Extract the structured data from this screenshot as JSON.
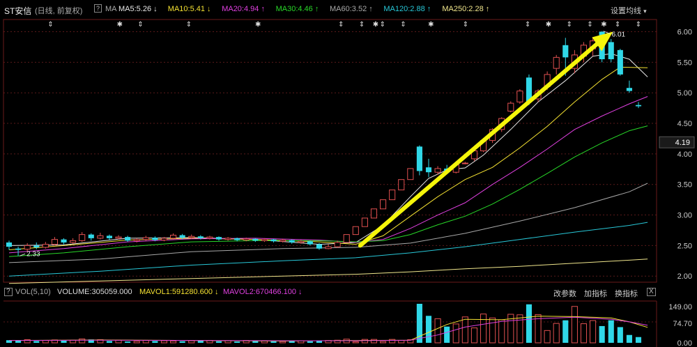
{
  "header": {
    "stock_name": "ST安信",
    "period_label": "(日线, 前复权)",
    "help_icon": "?",
    "ma_label": "MA",
    "ma_items": [
      {
        "text": "MA5:5.26",
        "arrow": "↓",
        "color": "#e8e8e8"
      },
      {
        "text": "MA10:5.41",
        "arrow": "↓",
        "color": "#f5e232"
      },
      {
        "text": "MA20:4.94",
        "arrow": "↑",
        "color": "#e040e0"
      },
      {
        "text": "MA30:4.46",
        "arrow": "↑",
        "color": "#28d828"
      },
      {
        "text": "MA60:3.52",
        "arrow": "↑",
        "color": "#a8a8a8"
      },
      {
        "text": "MA120:2.88",
        "arrow": "↑",
        "color": "#28c8d8"
      },
      {
        "text": "MA250:2.28",
        "arrow": "↑",
        "color": "#f0e68c"
      }
    ],
    "settings_label": "设置均线",
    "settings_arrow": "▾"
  },
  "volume_bar": {
    "help_icon": "?",
    "vol_label": "VOL(5,10)",
    "volume_text": "VOLUME:305059.000",
    "mavol1_text": "MAVOL1:591280.600",
    "mavol1_arrow": "↓",
    "mavol2_text": "MAVOL2:670466.100",
    "mavol2_arrow": "↓",
    "btn_params": "改参数",
    "btn_add": "加指标",
    "btn_switch": "换指标",
    "close_icon": "X"
  },
  "price_axis": {
    "ticks": [
      "6.00",
      "5.50",
      "5.00",
      "4.50",
      "4.00",
      "3.50",
      "3.00",
      "2.50",
      "2.00"
    ],
    "current_price": "4.19"
  },
  "volume_axis": {
    "ticks": [
      "149.00",
      "74.70",
      "0.00"
    ]
  },
  "annotations": {
    "high_label": "6.01",
    "low_label": "2.33"
  },
  "colors": {
    "up": "#e05050",
    "down": "#30d8e8",
    "arrow": "#f5f50a",
    "grid": "#5a1a1a"
  },
  "chart_data": {
    "type": "candlestick",
    "title": "ST安信",
    "ylim": [
      1.9,
      6.2
    ],
    "volume_ylim": [
      0,
      149
    ],
    "candles": [
      {
        "o": 2.55,
        "c": 2.48,
        "h": 2.58,
        "l": 2.43
      },
      {
        "o": 2.45,
        "c": 2.43,
        "h": 2.48,
        "l": 2.33
      },
      {
        "o": 2.44,
        "c": 2.5,
        "h": 2.54,
        "l": 2.4
      },
      {
        "o": 2.5,
        "c": 2.47,
        "h": 2.55,
        "l": 2.44
      },
      {
        "o": 2.47,
        "c": 2.52,
        "h": 2.56,
        "l": 2.45
      },
      {
        "o": 2.52,
        "c": 2.6,
        "h": 2.64,
        "l": 2.5
      },
      {
        "o": 2.6,
        "c": 2.55,
        "h": 2.62,
        "l": 2.52
      },
      {
        "o": 2.55,
        "c": 2.58,
        "h": 2.62,
        "l": 2.53
      },
      {
        "o": 2.58,
        "c": 2.68,
        "h": 2.72,
        "l": 2.56
      },
      {
        "o": 2.68,
        "c": 2.62,
        "h": 2.7,
        "l": 2.58
      },
      {
        "o": 2.62,
        "c": 2.66,
        "h": 2.71,
        "l": 2.6
      },
      {
        "o": 2.66,
        "c": 2.62,
        "h": 2.68,
        "l": 2.59
      },
      {
        "o": 2.62,
        "c": 2.64,
        "h": 2.67,
        "l": 2.6
      },
      {
        "o": 2.64,
        "c": 2.58,
        "h": 2.66,
        "l": 2.56
      },
      {
        "o": 2.58,
        "c": 2.6,
        "h": 2.62,
        "l": 2.55
      },
      {
        "o": 2.6,
        "c": 2.63,
        "h": 2.66,
        "l": 2.58
      },
      {
        "o": 2.63,
        "c": 2.59,
        "h": 2.65,
        "l": 2.57
      },
      {
        "o": 2.59,
        "c": 2.62,
        "h": 2.64,
        "l": 2.57
      },
      {
        "o": 2.62,
        "c": 2.67,
        "h": 2.7,
        "l": 2.6
      },
      {
        "o": 2.67,
        "c": 2.63,
        "h": 2.69,
        "l": 2.6
      },
      {
        "o": 2.63,
        "c": 2.65,
        "h": 2.68,
        "l": 2.61
      },
      {
        "o": 2.65,
        "c": 2.62,
        "h": 2.67,
        "l": 2.6
      },
      {
        "o": 2.62,
        "c": 2.64,
        "h": 2.66,
        "l": 2.6
      },
      {
        "o": 2.64,
        "c": 2.6,
        "h": 2.65,
        "l": 2.58
      },
      {
        "o": 2.6,
        "c": 2.62,
        "h": 2.64,
        "l": 2.58
      },
      {
        "o": 2.62,
        "c": 2.59,
        "h": 2.63,
        "l": 2.57
      },
      {
        "o": 2.59,
        "c": 2.61,
        "h": 2.63,
        "l": 2.57
      },
      {
        "o": 2.61,
        "c": 2.58,
        "h": 2.62,
        "l": 2.56
      },
      {
        "o": 2.58,
        "c": 2.6,
        "h": 2.62,
        "l": 2.56
      },
      {
        "o": 2.6,
        "c": 2.57,
        "h": 2.61,
        "l": 2.55
      },
      {
        "o": 2.57,
        "c": 2.59,
        "h": 2.61,
        "l": 2.55
      },
      {
        "o": 2.59,
        "c": 2.55,
        "h": 2.6,
        "l": 2.53
      },
      {
        "o": 2.55,
        "c": 2.57,
        "h": 2.59,
        "l": 2.53
      },
      {
        "o": 2.57,
        "c": 2.52,
        "h": 2.58,
        "l": 2.5
      },
      {
        "o": 2.52,
        "c": 2.45,
        "h": 2.54,
        "l": 2.43
      },
      {
        "o": 2.45,
        "c": 2.48,
        "h": 2.52,
        "l": 2.44
      },
      {
        "o": 2.48,
        "c": 2.55,
        "h": 2.58,
        "l": 2.46
      },
      {
        "o": 2.55,
        "c": 2.68,
        "h": 2.68,
        "l": 2.55
      },
      {
        "o": 2.68,
        "c": 2.81,
        "h": 2.81,
        "l": 2.68
      },
      {
        "o": 2.81,
        "c": 2.95,
        "h": 2.95,
        "l": 2.81
      },
      {
        "o": 2.95,
        "c": 3.1,
        "h": 3.1,
        "l": 2.95
      },
      {
        "o": 3.1,
        "c": 3.25,
        "h": 3.25,
        "l": 3.1
      },
      {
        "o": 3.25,
        "c": 3.41,
        "h": 3.41,
        "l": 3.25
      },
      {
        "o": 3.41,
        "c": 3.58,
        "h": 3.58,
        "l": 3.41
      },
      {
        "o": 3.58,
        "c": 3.76,
        "h": 3.76,
        "l": 3.58
      },
      {
        "o": 4.12,
        "c": 3.72,
        "h": 4.14,
        "l": 3.65
      },
      {
        "o": 3.78,
        "c": 3.7,
        "h": 3.92,
        "l": 3.62
      },
      {
        "o": 3.7,
        "c": 3.76,
        "h": 3.8,
        "l": 3.66
      },
      {
        "o": 3.76,
        "c": 3.7,
        "h": 3.82,
        "l": 3.68
      },
      {
        "o": 3.7,
        "c": 3.82,
        "h": 3.84,
        "l": 3.68
      },
      {
        "o": 3.85,
        "c": 3.85,
        "h": 3.87,
        "l": 3.83
      },
      {
        "o": 3.92,
        "c": 4.05,
        "h": 4.08,
        "l": 3.88
      },
      {
        "o": 4.05,
        "c": 4.22,
        "h": 4.25,
        "l": 4.03
      },
      {
        "o": 4.22,
        "c": 4.4,
        "h": 4.42,
        "l": 4.18
      },
      {
        "o": 4.4,
        "c": 4.58,
        "h": 4.6,
        "l": 4.36
      },
      {
        "o": 4.7,
        "c": 4.83,
        "h": 4.86,
        "l": 4.68
      },
      {
        "o": 4.85,
        "c": 5.03,
        "h": 5.06,
        "l": 4.82
      },
      {
        "o": 5.25,
        "c": 4.86,
        "h": 5.3,
        "l": 4.8
      },
      {
        "o": 4.9,
        "c": 5.03,
        "h": 5.06,
        "l": 4.85
      },
      {
        "o": 5.1,
        "c": 5.3,
        "h": 5.35,
        "l": 5.05
      },
      {
        "o": 5.4,
        "c": 5.58,
        "h": 5.62,
        "l": 5.3
      },
      {
        "o": 5.78,
        "c": 5.58,
        "h": 5.9,
        "l": 5.28
      },
      {
        "o": 5.4,
        "c": 5.62,
        "h": 5.7,
        "l": 5.32
      },
      {
        "o": 5.6,
        "c": 5.78,
        "h": 5.83,
        "l": 5.5
      },
      {
        "o": 5.72,
        "c": 5.85,
        "h": 5.9,
        "l": 5.6
      },
      {
        "o": 6.0,
        "c": 5.55,
        "h": 6.01,
        "l": 5.5
      },
      {
        "o": 5.83,
        "c": 5.55,
        "h": 5.88,
        "l": 5.5
      },
      {
        "o": 5.7,
        "c": 5.3,
        "h": 5.72,
        "l": 5.28
      },
      {
        "o": 5.08,
        "c": 5.03,
        "h": 5.2,
        "l": 5.0
      },
      {
        "o": 4.8,
        "c": 4.78,
        "h": 4.85,
        "l": 4.75
      }
    ],
    "volume": [
      10,
      8,
      12,
      7,
      9,
      11,
      8,
      10,
      15,
      13,
      12,
      7,
      10,
      5,
      6,
      9,
      7,
      8,
      7,
      6,
      8,
      10,
      9,
      6,
      8,
      5,
      9,
      9,
      7,
      6,
      5,
      9,
      8,
      6,
      7,
      9,
      10,
      14,
      4,
      13,
      13,
      5,
      13,
      9,
      12,
      149,
      103,
      92,
      62,
      72,
      99,
      57,
      110,
      95,
      88,
      109,
      107,
      147,
      108,
      47,
      74,
      86,
      139,
      73,
      85,
      64,
      86,
      60,
      30,
      22
    ],
    "ma_lines": [
      {
        "name": "MA5",
        "color": "#e8e8e8",
        "points": [
          [
            0,
            2.5
          ],
          [
            6,
            2.51
          ],
          [
            13,
            2.62
          ],
          [
            20,
            2.63
          ],
          [
            27,
            2.6
          ],
          [
            34,
            2.52
          ],
          [
            38,
            2.55
          ],
          [
            41,
            2.83
          ],
          [
            44,
            3.3
          ],
          [
            46,
            3.6
          ],
          [
            48,
            3.74
          ],
          [
            50,
            3.77
          ],
          [
            52,
            3.98
          ],
          [
            55,
            4.4
          ],
          [
            58,
            4.85
          ],
          [
            61,
            5.2
          ],
          [
            64,
            5.6
          ],
          [
            66,
            5.64
          ],
          [
            68,
            5.55
          ],
          [
            70,
            5.26
          ]
        ]
      },
      {
        "name": "MA10",
        "color": "#f5e232",
        "points": [
          [
            0,
            2.43
          ],
          [
            6,
            2.5
          ],
          [
            13,
            2.59
          ],
          [
            20,
            2.62
          ],
          [
            27,
            2.6
          ],
          [
            34,
            2.56
          ],
          [
            38,
            2.52
          ],
          [
            41,
            2.66
          ],
          [
            44,
            2.98
          ],
          [
            47,
            3.3
          ],
          [
            50,
            3.58
          ],
          [
            53,
            3.78
          ],
          [
            56,
            4.1
          ],
          [
            59,
            4.45
          ],
          [
            62,
            4.85
          ],
          [
            65,
            5.22
          ],
          [
            67,
            5.42
          ],
          [
            70,
            5.41
          ]
        ]
      },
      {
        "name": "MA20",
        "color": "#e040e0",
        "points": [
          [
            0,
            2.38
          ],
          [
            6,
            2.45
          ],
          [
            13,
            2.56
          ],
          [
            20,
            2.61
          ],
          [
            27,
            2.62
          ],
          [
            34,
            2.59
          ],
          [
            38,
            2.55
          ],
          [
            41,
            2.6
          ],
          [
            44,
            2.78
          ],
          [
            47,
            3.0
          ],
          [
            50,
            3.2
          ],
          [
            53,
            3.5
          ],
          [
            56,
            3.78
          ],
          [
            59,
            4.08
          ],
          [
            62,
            4.4
          ],
          [
            65,
            4.62
          ],
          [
            68,
            4.82
          ],
          [
            70,
            4.94
          ]
        ]
      },
      {
        "name": "MA30",
        "color": "#28d828",
        "points": [
          [
            0,
            2.32
          ],
          [
            6,
            2.38
          ],
          [
            13,
            2.48
          ],
          [
            20,
            2.56
          ],
          [
            27,
            2.58
          ],
          [
            34,
            2.58
          ],
          [
            38,
            2.56
          ],
          [
            41,
            2.58
          ],
          [
            44,
            2.68
          ],
          [
            47,
            2.84
          ],
          [
            50,
            2.98
          ],
          [
            53,
            3.18
          ],
          [
            56,
            3.42
          ],
          [
            59,
            3.68
          ],
          [
            62,
            3.95
          ],
          [
            65,
            4.18
          ],
          [
            68,
            4.38
          ],
          [
            70,
            4.46
          ]
        ]
      },
      {
        "name": "MA60",
        "color": "#a8a8a8",
        "points": [
          [
            0,
            2.22
          ],
          [
            10,
            2.28
          ],
          [
            20,
            2.4
          ],
          [
            30,
            2.45
          ],
          [
            38,
            2.47
          ],
          [
            44,
            2.54
          ],
          [
            50,
            2.7
          ],
          [
            56,
            2.9
          ],
          [
            62,
            3.12
          ],
          [
            68,
            3.38
          ],
          [
            70,
            3.52
          ]
        ]
      },
      {
        "name": "MA120",
        "color": "#28c8d8",
        "points": [
          [
            0,
            2.0
          ],
          [
            10,
            2.08
          ],
          [
            20,
            2.18
          ],
          [
            30,
            2.25
          ],
          [
            38,
            2.3
          ],
          [
            44,
            2.38
          ],
          [
            50,
            2.48
          ],
          [
            56,
            2.6
          ],
          [
            62,
            2.72
          ],
          [
            68,
            2.83
          ],
          [
            70,
            2.88
          ]
        ]
      },
      {
        "name": "MA250",
        "color": "#f0e68c",
        "points": [
          [
            0,
            1.88
          ],
          [
            10,
            1.92
          ],
          [
            20,
            1.96
          ],
          [
            30,
            2.0
          ],
          [
            38,
            2.03
          ],
          [
            44,
            2.07
          ],
          [
            50,
            2.12
          ],
          [
            56,
            2.16
          ],
          [
            62,
            2.21
          ],
          [
            68,
            2.26
          ],
          [
            70,
            2.28
          ]
        ]
      }
    ],
    "vol_ma_lines": [
      {
        "name": "MAVOL1",
        "color": "#f5e232",
        "points": [
          [
            0,
            9
          ],
          [
            10,
            11
          ],
          [
            20,
            9
          ],
          [
            30,
            7
          ],
          [
            38,
            9
          ],
          [
            44,
            10
          ],
          [
            46,
            40
          ],
          [
            48,
            70
          ],
          [
            50,
            90
          ],
          [
            54,
            88
          ],
          [
            58,
            102
          ],
          [
            62,
            100
          ],
          [
            66,
            95
          ],
          [
            68,
            80
          ],
          [
            70,
            59
          ]
        ]
      },
      {
        "name": "MAVOL2",
        "color": "#e040e0",
        "points": [
          [
            0,
            9
          ],
          [
            10,
            10
          ],
          [
            20,
            9
          ],
          [
            30,
            8
          ],
          [
            38,
            8
          ],
          [
            44,
            10
          ],
          [
            47,
            30
          ],
          [
            50,
            60
          ],
          [
            54,
            82
          ],
          [
            58,
            92
          ],
          [
            62,
            98
          ],
          [
            66,
            90
          ],
          [
            68,
            80
          ],
          [
            70,
            67
          ]
        ]
      }
    ],
    "markers_top": [
      6,
      16,
      19,
      26,
      36,
      48,
      51,
      53,
      54,
      57,
      61,
      66,
      75,
      78,
      81,
      84,
      86,
      88,
      91
    ]
  }
}
